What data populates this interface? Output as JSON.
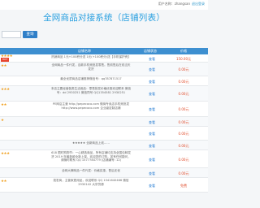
{
  "header": {
    "user_label": "用户名称：",
    "user_name": "zhangsan",
    "logout": "退出登录"
  },
  "page_title": "全网商品对接系统（店铺列表）",
  "search": {
    "button": "查询"
  },
  "table": {
    "columns": [
      "店铺名称",
      "店铺状态",
      "价格"
    ],
    "rows": [
      {
        "desc": "热销商品 1元+100积分送 1元(+100积分)送【手机保护壳】",
        "status": "查看",
        "price": "150.00元",
        "stars": "★★★★",
        "hot": "HOT"
      },
      {
        "desc": "全网商品一件代发，百款手机壳批发零售。售前售后在线当天发货",
        "status": "查看",
        "price": "0.00元",
        "stars": "★★",
        "hot": ""
      },
      {
        "desc": "最全优质商品店铺推荐微信号：qq787871517",
        "status": "查看",
        "price": "0.00元",
        "stars": "",
        "hot": ""
      },
      {
        "desc": "本店主要经营各类生活用品：零售批发价格优惠欢迎联系 微信号：dd 2930251 微信同号 QQ1354581 2930251",
        "status": "查看",
        "price": "0.00元",
        "stars": "★★★",
        "hot": ""
      },
      {
        "desc": "PE网店主营 http://pepecoco.com 微商专卖店手机壳批发 http://www.pepecoco.com 企业级定制店铺",
        "status": "查看",
        "price": "0.00元",
        "stars": "★★",
        "hot": ""
      },
      {
        "desc": "",
        "status": "查看",
        "price": "0.00元",
        "stars": "★",
        "hot": ""
      },
      {
        "desc": "",
        "status": "查看",
        "price": "0.00元",
        "stars": "",
        "hot": ""
      },
      {
        "desc": "★★★★★ 全新商品上线……",
        "status": "查看",
        "price": "0.00元",
        "stars": "",
        "hot": ""
      },
      {
        "desc": "618 限时购物节：一心精选商品，所有店铺均支持全国包邮发货 2019 年最新款全新上架，欢迎您的订购，如有任何疑问，请随时联系 QQ 1577784779 (店铺编号: 12)",
        "status": "查看",
        "price": "0.00元",
        "stars": "★★★",
        "hot": ""
      },
      {
        "desc": "全网大牌商品一件代发：价格实惠，售后无忧",
        "status": "查看",
        "price": "0.00元",
        "stars": "",
        "hot": ""
      },
      {
        "desc": "批发商，主营家居用品，欢迎联系 QQ 1541640466 微信 2930142 大宗货源",
        "status": "查看",
        "price": "免费",
        "stars": "★★",
        "hot": ""
      }
    ]
  },
  "pager": {
    "current": "1"
  }
}
